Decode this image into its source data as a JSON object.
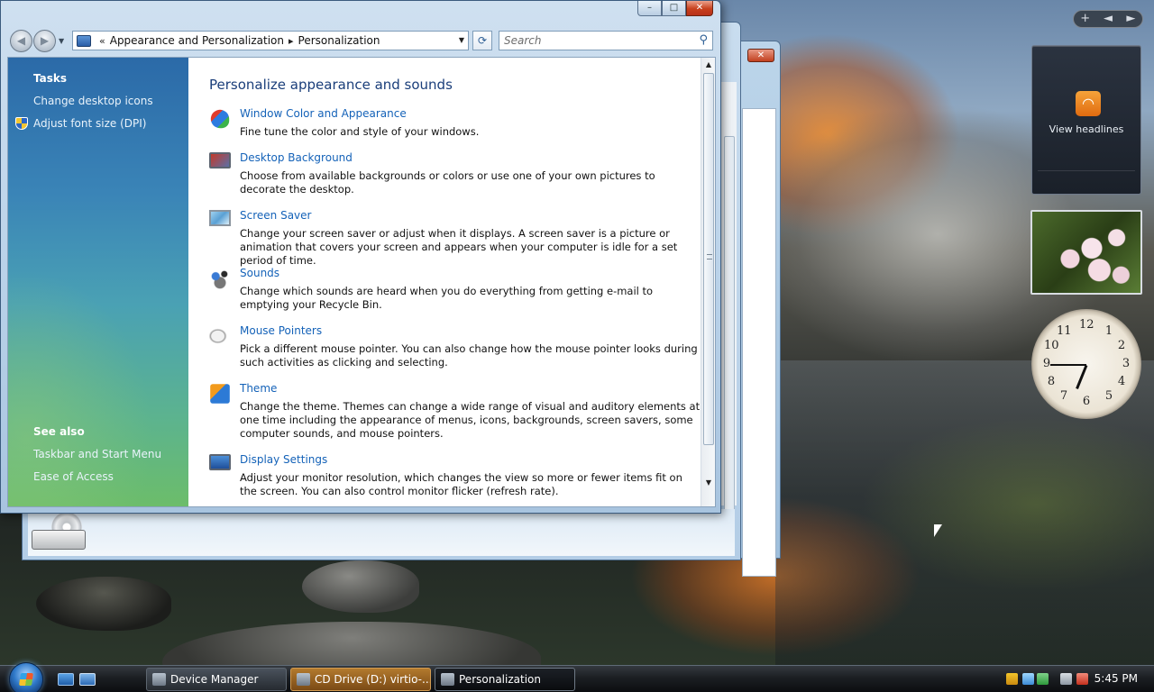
{
  "window": {
    "breadcrumb": [
      "Appearance and Personalization",
      "Personalization"
    ],
    "breadcrumb_prefix": "«",
    "search_placeholder": "Search",
    "caption": {
      "minimize": "–",
      "maximize": "□",
      "close": "✕"
    }
  },
  "tasks": {
    "heading": "Tasks",
    "links": [
      "Change desktop icons",
      "Adjust font size (DPI)"
    ],
    "see_also_heading": "See also",
    "see_also_links": [
      "Taskbar and Start Menu",
      "Ease of Access"
    ]
  },
  "main": {
    "title": "Personalize appearance and sounds",
    "items": [
      {
        "title": "Window Color and Appearance",
        "desc": "Fine tune the color and style of your windows.",
        "icon": "palette-icon"
      },
      {
        "title": "Desktop Background",
        "desc": "Choose from available backgrounds or colors or use one of your own pictures to decorate the desktop.",
        "icon": "desktop-background-icon"
      },
      {
        "title": "Screen Saver",
        "desc": "Change your screen saver or adjust when it displays. A screen saver is a picture or animation that covers your screen and appears when your computer is idle for a set period of time.",
        "icon": "screen-saver-icon"
      },
      {
        "title": "Sounds",
        "desc": "Change which sounds are heard when you do everything from getting e-mail to emptying your Recycle Bin.",
        "icon": "sounds-icon"
      },
      {
        "title": "Mouse Pointers",
        "desc": "Pick a different mouse pointer. You can also change how the mouse pointer looks during such activities as clicking and selecting.",
        "icon": "mouse-pointer-icon"
      },
      {
        "title": "Theme",
        "desc": "Change the theme. Themes can change a wide range of visual and auditory elements at one time including the appearance of menus, icons, backgrounds, screen savers, some computer sounds, and mouse pointers.",
        "icon": "theme-icon"
      },
      {
        "title": "Display Settings",
        "desc": "Adjust your monitor resolution, which changes the view so more or fewer items fit on the screen. You can also control monitor flicker (refresh rate).",
        "icon": "display-settings-icon"
      }
    ]
  },
  "sidebar": {
    "controls": [
      "+",
      "◄",
      "►"
    ],
    "feed_label": "View headlines",
    "clock_numbers": [
      "12",
      "1",
      "2",
      "3",
      "4",
      "5",
      "6",
      "7",
      "8",
      "9",
      "10",
      "11"
    ],
    "clock_time": "5:45"
  },
  "taskbar": {
    "tasks": [
      {
        "label": "Device Manager",
        "state": "normal"
      },
      {
        "label": "CD Drive (D:) virtio-...",
        "state": "alert"
      },
      {
        "label": "Personalization",
        "state": "active"
      }
    ],
    "time": "5:45 PM"
  },
  "colors": {
    "link": "#1462b8",
    "heading": "#1a3e7a",
    "close_red": "#c7401d"
  }
}
